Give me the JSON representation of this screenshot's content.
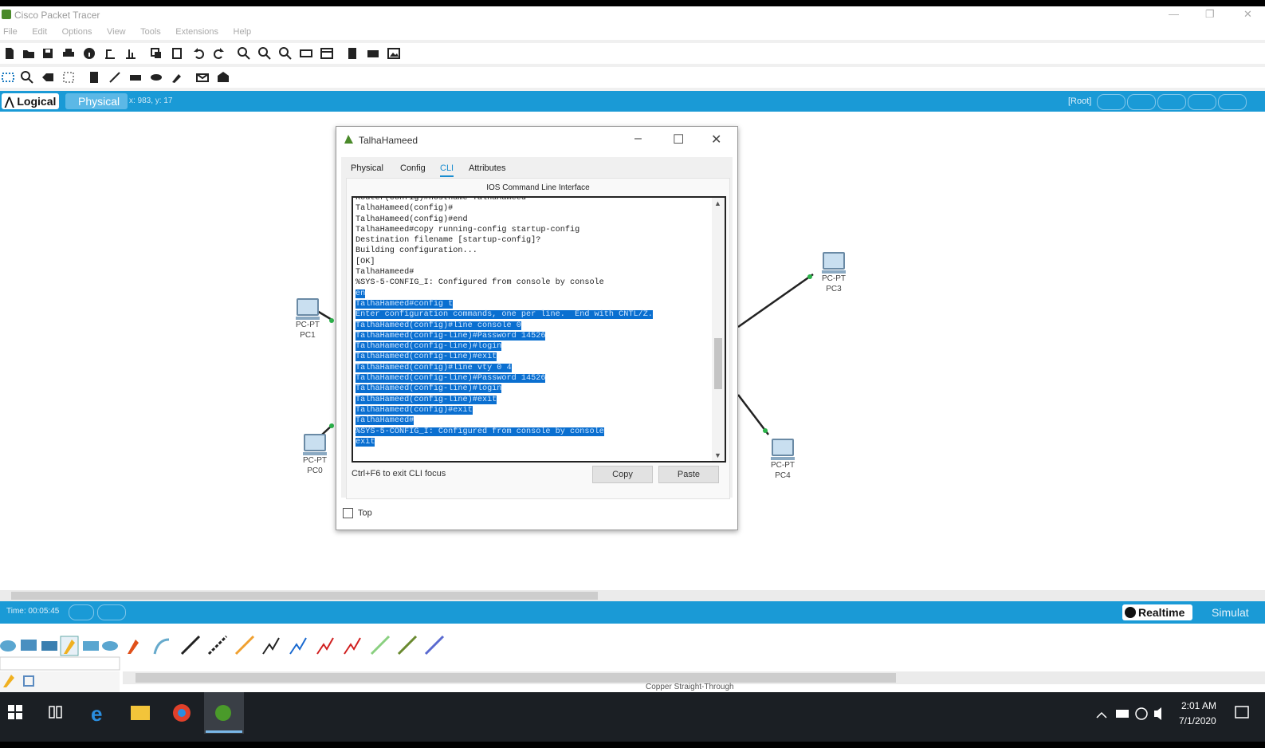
{
  "window": {
    "title": "Cisco Packet Tracer"
  },
  "menu": [
    "File",
    "Edit",
    "Options",
    "View",
    "Tools",
    "Extensions",
    "Help"
  ],
  "tabs_bar": {
    "logical": "Logical",
    "physical": "Physical",
    "coords": "x: 983, y: 17",
    "root": "[Root]"
  },
  "dialog": {
    "title": "TalhaHameed",
    "tabs": [
      "Physical",
      "Config",
      "CLI",
      "Attributes"
    ],
    "active_tab": "CLI",
    "cli_title": "IOS Command Line Interface",
    "terminal_lines": [
      {
        "text": "Router(config)#hostname TalhaHameed",
        "selected": false
      },
      {
        "text": "TalhaHameed(config)#",
        "selected": false
      },
      {
        "text": "TalhaHameed(config)#end",
        "selected": false
      },
      {
        "text": "TalhaHameed#copy running-config startup-config",
        "selected": false
      },
      {
        "text": "Destination filename [startup-config]?",
        "selected": false
      },
      {
        "text": "Building configuration...",
        "selected": false
      },
      {
        "text": "[OK]",
        "selected": false
      },
      {
        "text": "TalhaHameed#",
        "selected": false
      },
      {
        "text": "%SYS-5-CONFIG_I: Configured from console by console",
        "selected": false
      },
      {
        "text": "en",
        "selected": true
      },
      {
        "text": "TalhaHameed#config t",
        "selected": true
      },
      {
        "text": "Enter configuration commands, one per line.  End with CNTL/Z.",
        "selected": true
      },
      {
        "text": "TalhaHameed(config)#line console 0",
        "selected": true
      },
      {
        "text": "TalhaHameed(config-line)#Password 14526",
        "selected": true
      },
      {
        "text": "TalhaHameed(config-line)#login",
        "selected": true
      },
      {
        "text": "TalhaHameed(config-line)#exit",
        "selected": true
      },
      {
        "text": "TalhaHameed(config)#line vty 0 4",
        "selected": true
      },
      {
        "text": "TalhaHameed(config-line)#Password 14526",
        "selected": true
      },
      {
        "text": "TalhaHameed(config-line)#login",
        "selected": true
      },
      {
        "text": "TalhaHameed(config-line)#exit",
        "selected": true
      },
      {
        "text": "TalhaHameed(config)#exit",
        "selected": true
      },
      {
        "text": "TalhaHameed#",
        "selected": true
      },
      {
        "text": "%SYS-5-CONFIG_I: Configured from console by console",
        "selected": true
      },
      {
        "text": "exit",
        "selected": true
      }
    ],
    "hint": "Ctrl+F6 to exit CLI focus",
    "copy_label": "Copy",
    "paste_label": "Paste",
    "top_label": "Top"
  },
  "devices": [
    {
      "type": "PC-PT",
      "name": "PC1"
    },
    {
      "type": "PC-PT",
      "name": "PC0"
    },
    {
      "type": "PC-PT",
      "name": "PC3"
    },
    {
      "type": "PC-PT",
      "name": "PC4"
    }
  ],
  "bottom": {
    "time": "Time: 00:05:45",
    "realtime": "Realtime",
    "simulation": "Simulat",
    "status": "Copper Straight-Through"
  },
  "taskbar": {
    "time": "2:01 AM",
    "date": "7/1/2020"
  },
  "colors": {
    "accent": "#1a9ad6",
    "selection": "#0a6fd0",
    "taskbar": "#1b1f24"
  }
}
